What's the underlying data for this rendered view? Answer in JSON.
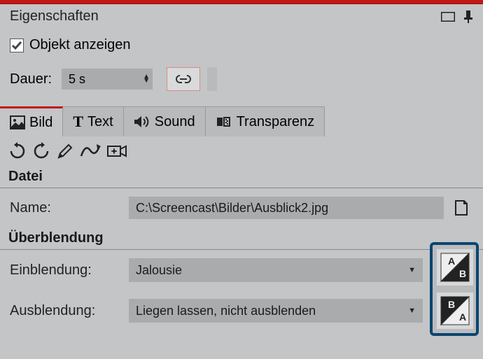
{
  "title": "Eigenschaften",
  "showObject": {
    "checked": true,
    "label": "Objekt anzeigen"
  },
  "duration": {
    "label": "Dauer:",
    "value": "5 s"
  },
  "tabs": [
    {
      "label": "Bild",
      "active": true
    },
    {
      "label": "Text",
      "active": false
    },
    {
      "label": "Sound",
      "active": false
    },
    {
      "label": "Transparenz",
      "active": false
    }
  ],
  "sections": {
    "file": {
      "header": "Datei",
      "name": {
        "label": "Name:",
        "value": "C:\\Screencast\\Bilder\\Ausblick2.jpg"
      }
    },
    "transition": {
      "header": "Überblendung",
      "fadeIn": {
        "label": "Einblendung:",
        "value": "Jalousie"
      },
      "fadeOut": {
        "label": "Ausblendung:",
        "value": "Liegen lassen, nicht ausblenden"
      }
    }
  }
}
